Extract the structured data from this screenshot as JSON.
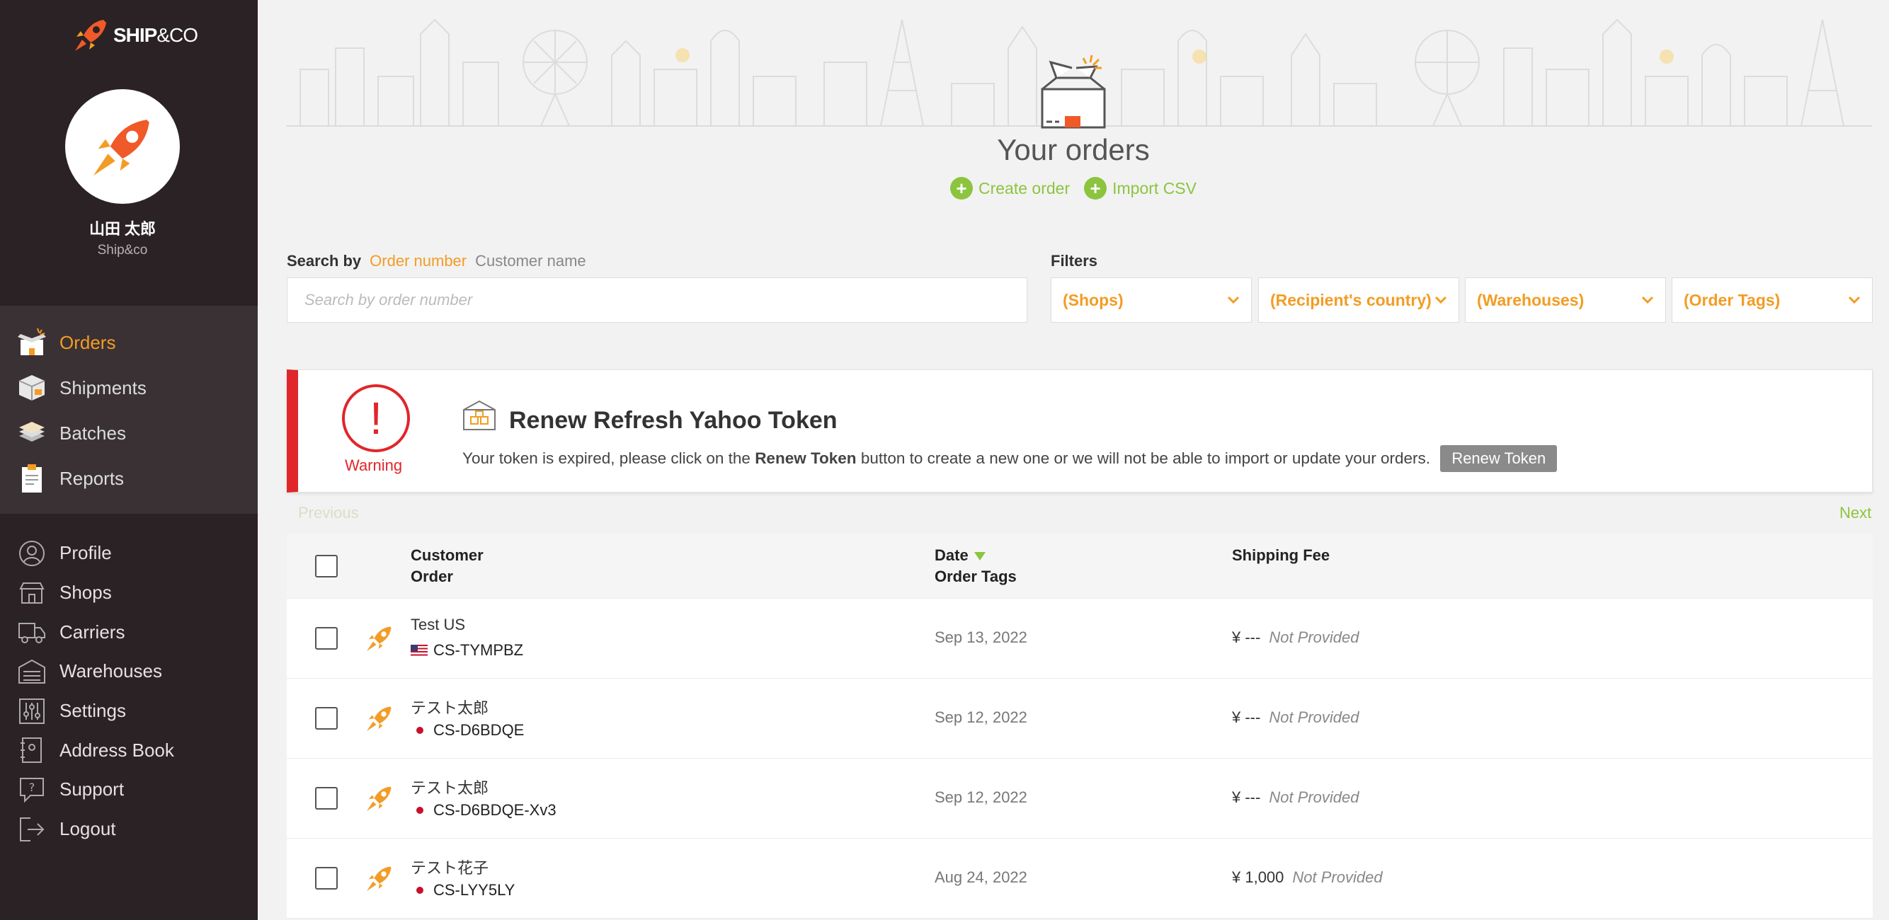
{
  "brand": {
    "name_bold": "SHIP",
    "name_rest": "&CO"
  },
  "user": {
    "name": "山田 太郎",
    "org": "Ship&co"
  },
  "nav_main": [
    {
      "label": "Orders",
      "icon": "orders-icon",
      "active": true
    },
    {
      "label": "Shipments",
      "icon": "shipments-icon"
    },
    {
      "label": "Batches",
      "icon": "batches-icon"
    },
    {
      "label": "Reports",
      "icon": "reports-icon"
    }
  ],
  "nav_secondary": [
    {
      "label": "Profile",
      "icon": "profile-icon"
    },
    {
      "label": "Shops",
      "icon": "shops-icon"
    },
    {
      "label": "Carriers",
      "icon": "carriers-icon"
    },
    {
      "label": "Warehouses",
      "icon": "warehouses-icon"
    },
    {
      "label": "Settings",
      "icon": "settings-icon"
    },
    {
      "label": "Address Book",
      "icon": "address-book-icon"
    },
    {
      "label": "Support",
      "icon": "support-icon"
    },
    {
      "label": "Logout",
      "icon": "logout-icon"
    }
  ],
  "page": {
    "title": "Your orders",
    "create_order": "Create order",
    "import_csv": "Import CSV"
  },
  "search": {
    "label": "Search by",
    "option_active": "Order number",
    "option_other": "Customer name",
    "placeholder": "Search by order number"
  },
  "filters": {
    "label": "Filters",
    "items": [
      "(Shops)",
      "(Recipient's country)",
      "(Warehouses)",
      "(Order Tags)"
    ]
  },
  "warning": {
    "label": "Warning",
    "title": "Renew Refresh Yahoo Token",
    "text_before": "Your token is expired, please click on the",
    "text_bold": "Renew Token",
    "text_after": "button to create a new one or we will not be able to import or update your orders.",
    "button": "Renew Token"
  },
  "pagination": {
    "previous": "Previous",
    "next": "Next"
  },
  "table": {
    "headers": {
      "customer": "Customer",
      "order": "Order",
      "date": "Date",
      "order_tags": "Order Tags",
      "shipping_fee": "Shipping Fee"
    },
    "rows": [
      {
        "customer": "Test US",
        "order": "CS-TYMPBZ",
        "country": "US",
        "date": "Sep 13, 2022",
        "fee": "¥ ---",
        "fee_status": "Not Provided"
      },
      {
        "customer": "テスト太郎",
        "order": "CS-D6BDQE",
        "country": "JP",
        "date": "Sep 12, 2022",
        "fee": "¥ ---",
        "fee_status": "Not Provided"
      },
      {
        "customer": "テスト太郎",
        "order": "CS-D6BDQE-Xv3",
        "country": "JP",
        "date": "Sep 12, 2022",
        "fee": "¥ ---",
        "fee_status": "Not Provided"
      },
      {
        "customer": "テスト花子",
        "order": "CS-LYY5LY",
        "country": "JP",
        "date": "Aug 24, 2022",
        "fee": "¥ 1,000",
        "fee_status": "Not Provided"
      }
    ]
  },
  "colors": {
    "accent": "#f39c24",
    "green": "#8cc43f",
    "sidebar": "#2b2225",
    "warning": "#e0262a"
  }
}
